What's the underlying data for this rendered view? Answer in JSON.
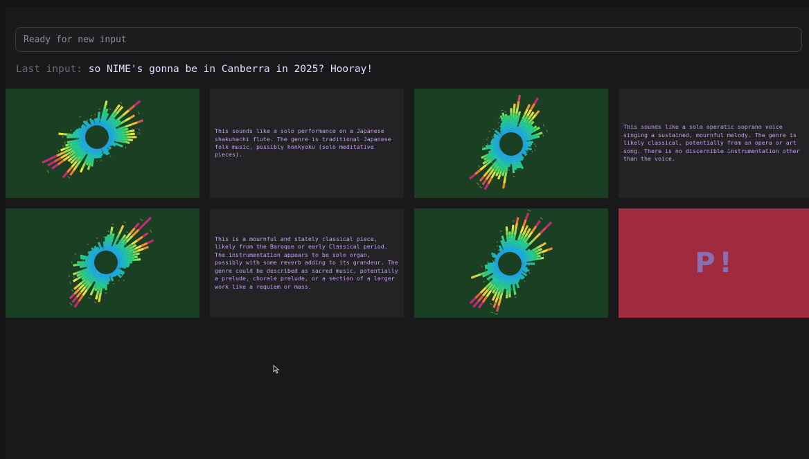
{
  "input": {
    "placeholder": "Ready for new input",
    "value": ""
  },
  "last_input": {
    "label": "Last input:",
    "value": "so NIME's gonna be in Canberra in 2025? Hooray!"
  },
  "tiles": [
    {
      "kind": "visualizer",
      "name": "visualizer-1",
      "seed": 3
    },
    {
      "kind": "description",
      "text": "This sounds like a solo performance on a Japanese shakuhachi flute. The genre is traditional Japanese folk music, possibly honkyoku (solo meditative pieces)."
    },
    {
      "kind": "visualizer",
      "name": "visualizer-2",
      "seed": 11
    },
    {
      "kind": "description",
      "text": "This sounds like a solo operatic soprano voice singing a sustained, mournful melody. The genre is likely classical, potentially from an opera or art song. There is no discernible instrumentation other than the voice."
    },
    {
      "kind": "visualizer",
      "name": "visualizer-3",
      "seed": 7
    },
    {
      "kind": "description",
      "text": "This is a mournful and stately classical piece, likely from the Baroque or early Classical period. The instrumentation appears to be solo organ, possibly with some reverb adding to its grandeur. The genre could be described as sacred music, potentially a prelude, chorale prelude, or a section of a larger work like a requiem or mass."
    },
    {
      "kind": "visualizer",
      "name": "visualizer-4",
      "seed": 19
    },
    {
      "kind": "pending",
      "text": "P!"
    }
  ],
  "colors": {
    "viz_bg": "#1a3f22",
    "text_tile_bg": "#232326",
    "text_color": "#c79ef5",
    "pending_bg": "#a02b3e"
  }
}
